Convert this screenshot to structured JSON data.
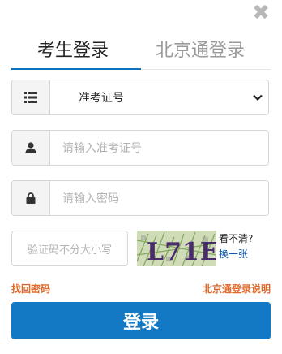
{
  "close_label": "✖",
  "tabs": [
    {
      "label": "考生登录",
      "active": true
    },
    {
      "label": "北京通登录",
      "active": false
    }
  ],
  "form": {
    "id_type": {
      "selected": "准考证号",
      "icon": "list-icon"
    },
    "username": {
      "placeholder": "请输入准考证号",
      "icon": "user-icon"
    },
    "password": {
      "placeholder": "请输入密码",
      "icon": "lock-icon"
    },
    "captcha": {
      "placeholder": "验证码不分大小写",
      "image_text": "L71E",
      "hint": "看不清?",
      "refresh_label": "换一张"
    }
  },
  "links": {
    "forgot_password": "找回密码",
    "bjt_help": "北京通登录说明"
  },
  "submit_label": "登录",
  "colors": {
    "accent": "#1479c4",
    "link_orange": "#e06a2c",
    "refresh_blue": "#0a55b0"
  }
}
